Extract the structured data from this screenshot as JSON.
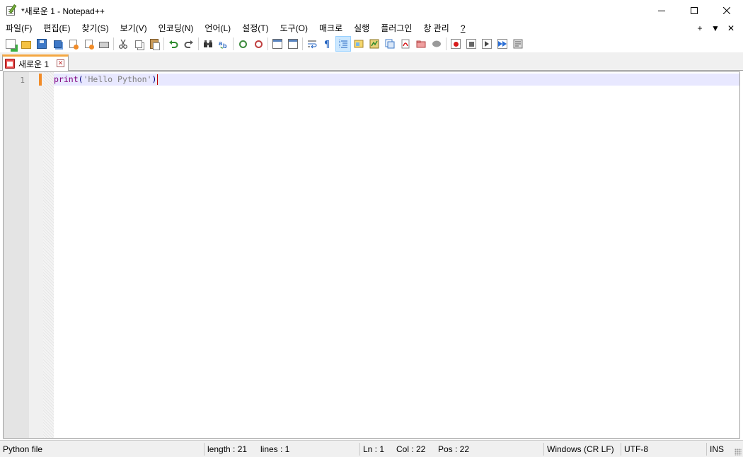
{
  "window": {
    "title": "*새로운 1 - Notepad++"
  },
  "menu": {
    "items": [
      "파일(F)",
      "편집(E)",
      "찾기(S)",
      "보기(V)",
      "인코딩(N)",
      "언어(L)",
      "설정(T)",
      "도구(O)",
      "매크로",
      "실행",
      "플러그인",
      "창 관리",
      "?"
    ],
    "right": [
      "+",
      "▼",
      "✕"
    ]
  },
  "toolbar": {
    "icons": [
      "new-file",
      "open-file",
      "save",
      "save-all",
      "close",
      "close-all",
      "print",
      "cut",
      "copy",
      "paste",
      "undo",
      "redo",
      "find",
      "replace",
      "zoom-in",
      "zoom-out",
      "sync-vertical",
      "sync-horizontal",
      "word-wrap",
      "show-all-chars",
      "indent-guide",
      "user-defined-language",
      "doc-map",
      "function-list",
      "folder-as-workspace",
      "monitoring",
      "record-macro",
      "stop-recording",
      "playback",
      "run-macro-multiple",
      "save-macro"
    ]
  },
  "tab": {
    "label": "새로운 1",
    "close": "✕"
  },
  "editor": {
    "line_number": "1",
    "code_keyword": "print",
    "code_open": "(",
    "code_string": "'Hello Python'",
    "code_close": ")"
  },
  "status": {
    "file_type": "Python file",
    "length": "length : 21",
    "lines": "lines : 1",
    "ln": "Ln : 1",
    "col": "Col : 22",
    "pos": "Pos : 22",
    "eol": "Windows (CR LF)",
    "encoding": "UTF-8",
    "mode": "INS"
  },
  "colors": {
    "tab_accent": "#f5a742",
    "current_line": "#e8e8ff",
    "keyword": "#800080",
    "string": "#808080",
    "caret": "#c00000"
  }
}
